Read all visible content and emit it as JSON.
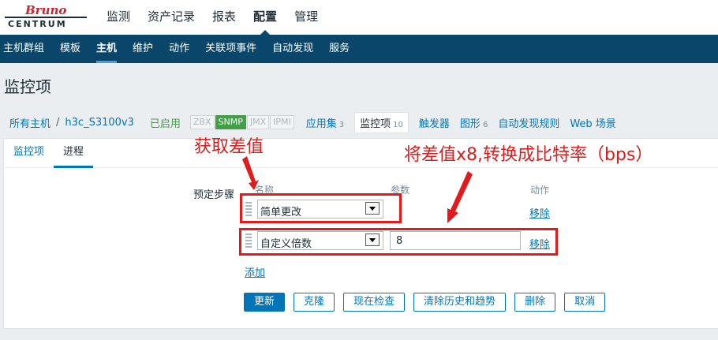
{
  "logo": {
    "line1": "Bruno",
    "line2": "CENTRUM"
  },
  "top_menu": [
    {
      "label": "监测",
      "active": false
    },
    {
      "label": "资产记录",
      "active": false
    },
    {
      "label": "报表",
      "active": false
    },
    {
      "label": "配置",
      "active": true
    },
    {
      "label": "管理",
      "active": false
    }
  ],
  "sub_menu": [
    {
      "label": "主机群组",
      "active": false
    },
    {
      "label": "模板",
      "active": false
    },
    {
      "label": "主机",
      "active": true
    },
    {
      "label": "维护",
      "active": false
    },
    {
      "label": "动作",
      "active": false
    },
    {
      "label": "关联项事件",
      "active": false
    },
    {
      "label": "自动发现",
      "active": false
    },
    {
      "label": "服务",
      "active": false
    }
  ],
  "page_title": "监控项",
  "breadcrumb": {
    "all_hosts": "所有主机",
    "separator": "/",
    "host": "h3c_S3100v3",
    "status": "已启用"
  },
  "availability_tags": [
    {
      "label": "ZBX",
      "on": false
    },
    {
      "label": "SNMP",
      "on": true
    },
    {
      "label": "JMX",
      "on": false
    },
    {
      "label": "IPMI",
      "on": false
    }
  ],
  "host_nav": [
    {
      "label": "应用集",
      "count": "3",
      "current": false
    },
    {
      "label": "监控项",
      "count": "10",
      "current": true
    },
    {
      "label": "触发器",
      "count": "",
      "current": false
    },
    {
      "label": "图形",
      "count": "6",
      "current": false
    },
    {
      "label": "自动发现规则",
      "count": "",
      "current": false
    },
    {
      "label": "Web 场景",
      "count": "",
      "current": false
    }
  ],
  "tabs": [
    {
      "label": "监控项",
      "active": false
    },
    {
      "label": "进程",
      "active": true
    }
  ],
  "form": {
    "steps_label": "预定步骤",
    "col_name": "名称",
    "col_params": "参数",
    "col_action": "动作",
    "steps": [
      {
        "type": "简单更改",
        "param": "",
        "remove": "移除"
      },
      {
        "type": "自定义倍数",
        "param": "8",
        "remove": "移除"
      }
    ],
    "add_label": "添加"
  },
  "buttons": {
    "update": "更新",
    "clone": "克隆",
    "check_now": "现在检查",
    "clear_history": "清除历史和趋势",
    "delete": "删除",
    "cancel": "取消"
  },
  "annotations": {
    "a1": "获取差值",
    "a2": "将差值x8,转换成比特率（bps）"
  },
  "colors": {
    "header_blue": "#0a466a",
    "link_blue": "#0275b8",
    "enabled_green": "#429e47",
    "annotation_red": "#e01b1b"
  }
}
